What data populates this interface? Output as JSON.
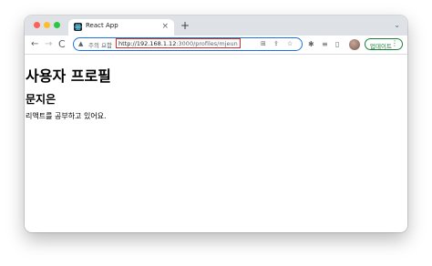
{
  "tab": {
    "title": "React App",
    "close_glyph": "×",
    "new_tab_glyph": "+",
    "menu_glyph": "⌄",
    "favicon": "react-icon"
  },
  "toolbar": {
    "back_glyph": "←",
    "forward_glyph": "→",
    "reload_glyph": "C",
    "security_warning": "주의 요함",
    "url_host": "http://192.168.1.12",
    "url_path": ":3000/profiles/mjeun",
    "update_label": "업데이트",
    "update_menu_glyph": "⋮",
    "accent_color": "#1a73e8",
    "update_color": "#188038",
    "highlight_color": "#d93025"
  },
  "page": {
    "heading": "사용자 프로필",
    "name": "문지은",
    "description": "리액트를 공부하고 있어요."
  }
}
